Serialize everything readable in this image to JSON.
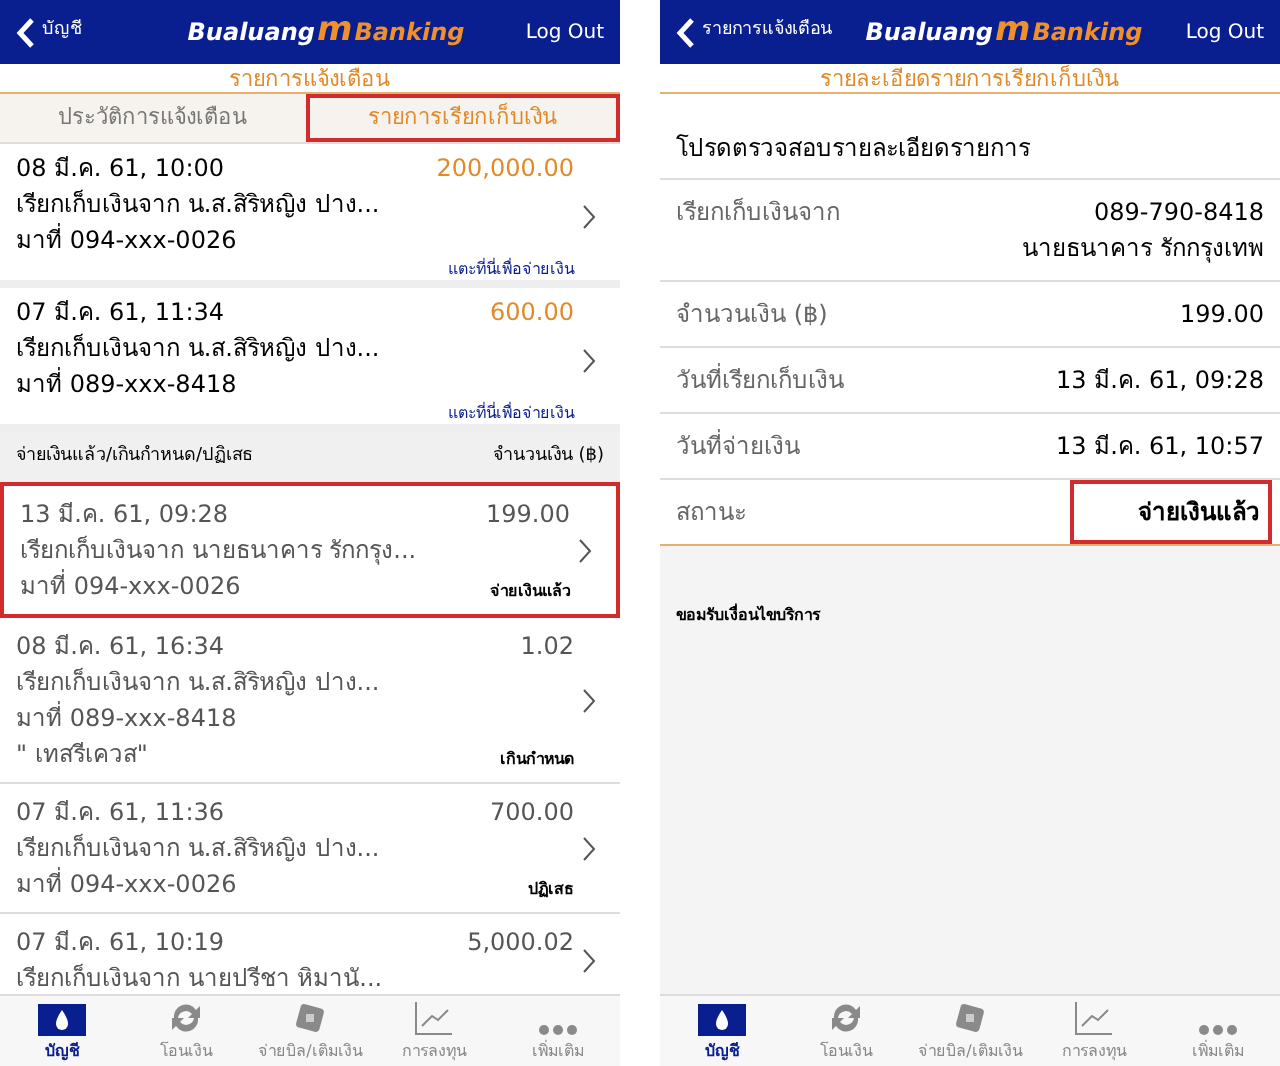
{
  "left": {
    "header": {
      "back": "บัญชี",
      "logo": [
        "Bualuang",
        "m",
        "Banking"
      ],
      "logout": "Log Out"
    },
    "subtitle": "รายการแจ้งเตือน",
    "tabs": [
      {
        "label": "ประวัติการแจ้งเตือน",
        "selected": false,
        "highlighted": false
      },
      {
        "label": "รายการเรียกเก็บเงิน",
        "selected": true,
        "highlighted": true
      }
    ],
    "pending": [
      {
        "date": "08 มี.ค. 61, 10:00",
        "amount": "200,000.00",
        "from": "เรียกเก็บเงินจาก น.ส.สิริหญิง ปาง...",
        "phone": "มาที่ 094-xxx-0026",
        "action": "แตะที่นี่เพื่อจ่ายเงิน"
      },
      {
        "date": "07 มี.ค. 61, 11:34",
        "amount": "600.00",
        "from": "เรียกเก็บเงินจาก น.ส.สิริหญิง ปาง...",
        "phone": "มาที่ 089-xxx-8418",
        "action": "แตะที่นี่เพื่อจ่ายเงิน"
      }
    ],
    "section": {
      "title": "จ่ายเงินแล้ว/เกินกำหนด/ปฏิเสธ",
      "amount_heading": "จำนวนเงิน (฿)"
    },
    "history": [
      {
        "date": "13 มี.ค. 61, 09:28",
        "amount": "199.00",
        "from": "เรียกเก็บเงินจาก นายธนาคาร รักกรุง...",
        "phone": "มาที่ 094-xxx-0026",
        "status": "จ่ายเงินแล้ว",
        "highlighted": true
      },
      {
        "date": "08 มี.ค. 61, 16:34",
        "amount": "1.02",
        "from": "เรียกเก็บเงินจาก น.ส.สิริหญิง ปาง...",
        "phone": "มาที่ 089-xxx-8418",
        "note": "\" เทสรีเควส\"",
        "status": "เกินกำหนด",
        "highlighted": false
      },
      {
        "date": "07 มี.ค. 61, 11:36",
        "amount": "700.00",
        "from": "เรียกเก็บเงินจาก น.ส.สิริหญิง ปาง...",
        "phone": "มาที่ 094-xxx-0026",
        "status": "ปฏิเสธ",
        "highlighted": false
      },
      {
        "date": "07 มี.ค. 61, 10:19",
        "amount": "5,000.02",
        "from": "เรียกเก็บเงินจาก นายปรีชา หิมานั...",
        "highlighted": false
      }
    ],
    "tabbar": [
      {
        "kind": "account",
        "label": "บัญชี",
        "selected": true
      },
      {
        "kind": "transfer",
        "label": "โอนเงิน",
        "selected": false
      },
      {
        "kind": "bill",
        "label": "จ่ายบิล/เติมเงิน",
        "selected": false
      },
      {
        "kind": "invest",
        "label": "การลงทุน",
        "selected": false
      },
      {
        "kind": "more",
        "label": "เพิ่มเติม",
        "selected": false
      }
    ]
  },
  "right": {
    "header": {
      "back": "รายการแจ้งเตือน",
      "logo": [
        "Bualuang",
        "m",
        "Banking"
      ],
      "logout": "Log Out"
    },
    "subtitle": "รายละเอียดรายการเรียกเก็บเงิน",
    "heading": "โปรดตรวจสอบรายละเอียดรายการ",
    "rows": [
      {
        "label": "เรียกเก็บเงินจาก",
        "values": [
          "089-790-8418",
          "นายธนาคาร รักกรุงเทพ"
        ],
        "highlighted": false
      },
      {
        "label": "จำนวนเงิน (฿)",
        "values": [
          "199.00"
        ],
        "highlighted": false
      },
      {
        "label": "วันที่เรียกเก็บเงิน",
        "values": [
          "13 มี.ค. 61, 09:28"
        ],
        "highlighted": false
      },
      {
        "label": "วันที่จ่ายเงิน",
        "values": [
          "13 มี.ค. 61, 10:57"
        ],
        "highlighted": false
      },
      {
        "label": "สถานะ",
        "values": [
          "จ่ายเงินแล้ว"
        ],
        "highlighted": true,
        "kind": "status"
      }
    ],
    "terms": "ขอมรับเงื่อนไขบริการ",
    "tabbar": [
      {
        "kind": "account",
        "label": "บัญชี",
        "selected": true
      },
      {
        "kind": "transfer",
        "label": "โอนเงิน",
        "selected": false
      },
      {
        "kind": "bill",
        "label": "จ่ายบิล/เติมเงิน",
        "selected": false
      },
      {
        "kind": "invest",
        "label": "การลงทุน",
        "selected": false
      },
      {
        "kind": "more",
        "label": "เพิ่มเติม",
        "selected": false
      }
    ]
  }
}
